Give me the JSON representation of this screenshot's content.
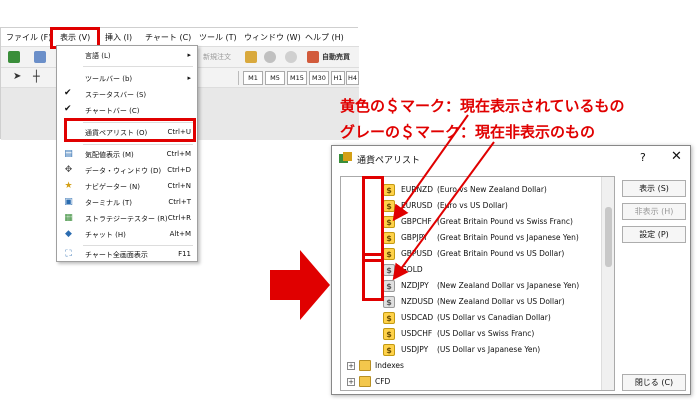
{
  "menubar": {
    "items": [
      "ファイル (F)",
      "表示 (V)",
      "挿入 (I)",
      "チャート (C)",
      "ツール (T)",
      "ウィンドウ (W)",
      "ヘルプ (H)"
    ]
  },
  "toolbar": {
    "new_order": "新規注文",
    "auto_trading": "自動売買",
    "timeframes": [
      "M1",
      "M5",
      "M15",
      "M30",
      "H1",
      "H4"
    ]
  },
  "view_menu": {
    "items": [
      {
        "label": "言語 (L)",
        "shortcut": "",
        "submenu": true
      },
      {
        "label": "ツールバー (b)",
        "shortcut": "",
        "submenu": true
      },
      {
        "label": "ステータスバー (S)",
        "shortcut": "",
        "checked": true
      },
      {
        "label": "チャートバー (C)",
        "shortcut": "",
        "checked": true
      },
      {
        "label": "通貨ペアリスト (O)",
        "shortcut": "Ctrl+U",
        "icon": "currency-list-icon"
      },
      {
        "label": "気配値表示 (M)",
        "shortcut": "Ctrl+M",
        "icon": "market-watch-icon"
      },
      {
        "label": "データ・ウィンドウ (D)",
        "shortcut": "Ctrl+D",
        "icon": "data-window-icon"
      },
      {
        "label": "ナビゲーター (N)",
        "shortcut": "Ctrl+N",
        "icon": "navigator-icon"
      },
      {
        "label": "ターミナル (T)",
        "shortcut": "Ctrl+T",
        "icon": "terminal-icon"
      },
      {
        "label": "ストラテジーテスター (R)",
        "shortcut": "Ctrl+R",
        "icon": "strategy-tester-icon"
      },
      {
        "label": "チャット (H)",
        "shortcut": "Alt+M",
        "icon": "chat-icon"
      },
      {
        "label": "チャート全画面表示",
        "shortcut": "F11",
        "icon": "fullscreen-icon"
      }
    ]
  },
  "annotations": {
    "yellow": "黄色の＄マーク：現在表示されているもの",
    "gray": "グレーの＄マーク：現在非表示のもの"
  },
  "dialog": {
    "title": "通貨ペアリスト",
    "help": "?",
    "close": "✕",
    "symbols": [
      {
        "symbol": "EURNZD",
        "desc": "(Euro vs New Zealand Dollar)",
        "visible": true
      },
      {
        "symbol": "EURUSD",
        "desc": "(Euro vs US Dollar)",
        "visible": true
      },
      {
        "symbol": "GBPCHF",
        "desc": "(Great Britain Pound vs Swiss Franc)",
        "visible": true
      },
      {
        "symbol": "GBPJPY",
        "desc": "(Great Britain Pound vs Japanese Yen)",
        "visible": true
      },
      {
        "symbol": "GBPUSD",
        "desc": "(Great Britain Pound vs US Dollar)",
        "visible": true
      },
      {
        "symbol": "GOLD",
        "desc": "",
        "visible": false
      },
      {
        "symbol": "NZDJPY",
        "desc": "(New Zealand Dollar vs Japanese Yen)",
        "visible": false
      },
      {
        "symbol": "NZDUSD",
        "desc": "(New Zealand Dollar vs US Dollar)",
        "visible": false
      },
      {
        "symbol": "USDCAD",
        "desc": "(US Dollar vs Canadian Dollar)",
        "visible": true
      },
      {
        "symbol": "USDCHF",
        "desc": "(US Dollar vs Swiss Franc)",
        "visible": true
      },
      {
        "symbol": "USDJPY",
        "desc": "(US Dollar vs Japanese Yen)",
        "visible": true
      }
    ],
    "folders": [
      "Indexes",
      "CFD"
    ],
    "buttons": {
      "show": "表示 (S)",
      "hide": "非表示 (H)",
      "settings": "設定 (P)",
      "close": "閉じる (C)"
    }
  },
  "colors": {
    "highlight_red": "#e00000",
    "coin_yellow": "#ffd24a",
    "coin_gray": "#e0e0e0"
  }
}
